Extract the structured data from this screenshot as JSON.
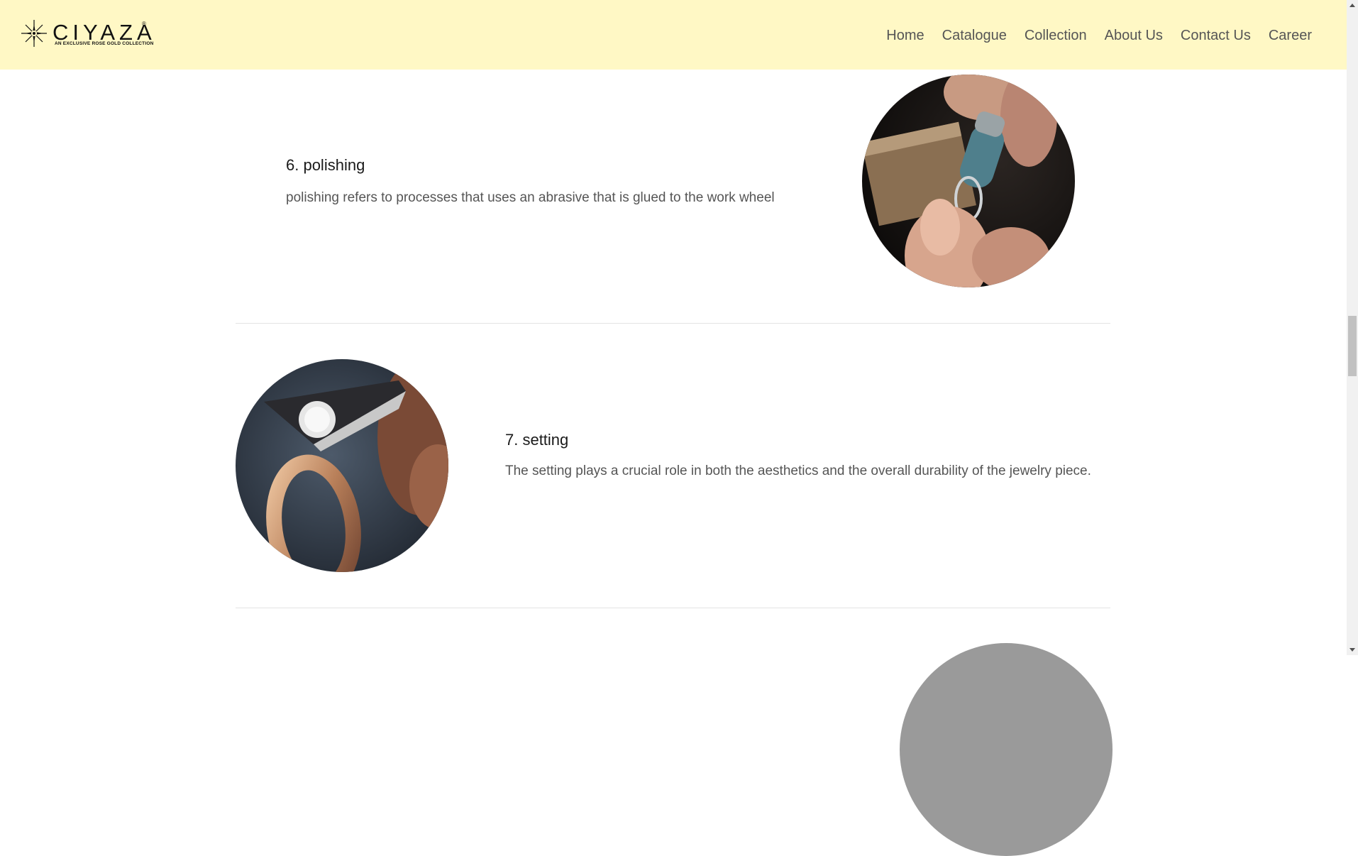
{
  "header": {
    "brand": "CIYAZA",
    "registered": "®",
    "tagline": "AN EXCLUSIVE ROSE GOLD COLLECTION",
    "nav": [
      "Home",
      "Catalogue",
      "Collection",
      "About Us",
      "Contact Us",
      "Career"
    ]
  },
  "steps": [
    {
      "title": "6. polishing",
      "description": "polishing refers to processes that uses an abrasive that is glued to the work wheel",
      "image_icon": "ring-polishing-photo"
    },
    {
      "title": "7. setting",
      "description": "The setting plays a crucial role in both the aesthetics and the overall durability of the jewelry piece.",
      "image_icon": "diamond-setting-photo"
    }
  ],
  "colors": {
    "header_bg": "#fff8c5",
    "nav_text": "#555555",
    "title_text": "#1a1a1a",
    "body_text": "#555555",
    "divider": "#e3e3e3"
  }
}
